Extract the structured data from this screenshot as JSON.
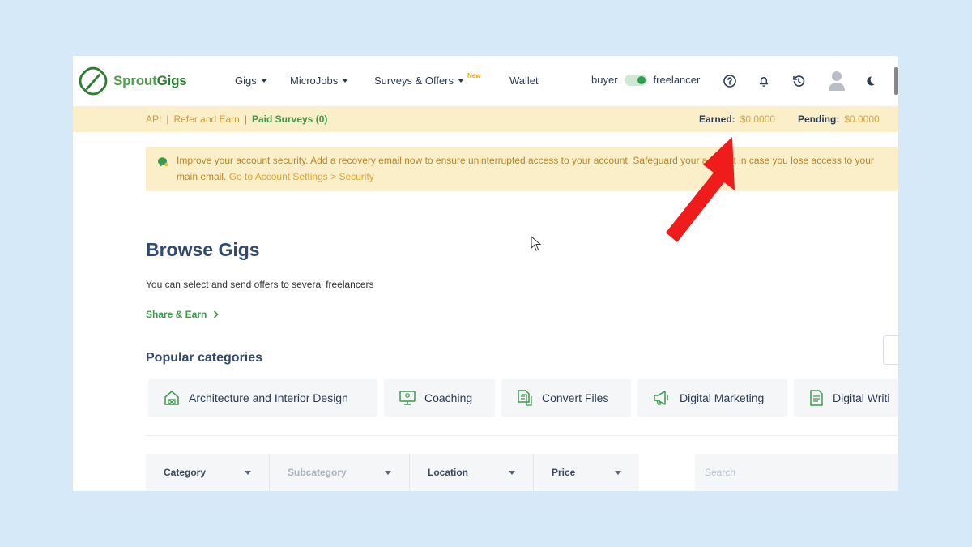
{
  "brand": {
    "name_light": "Sprout",
    "name_bold": "Gigs"
  },
  "nav": {
    "items": [
      {
        "label": "Gigs",
        "has_caret": true
      },
      {
        "label": "MicroJobs",
        "has_caret": true
      },
      {
        "label": "Surveys & Offers",
        "has_caret": true,
        "badge": "New"
      },
      {
        "label": "Wallet",
        "has_caret": false
      }
    ],
    "mode": {
      "left": "buyer",
      "right": "freelancer",
      "active": "freelancer"
    },
    "icons": [
      "help-icon",
      "bell-icon",
      "history-icon",
      "avatar",
      "dark-mode-icon"
    ]
  },
  "subbar": {
    "links": [
      "API",
      "Refer and Earn",
      "Paid Surveys (0)"
    ],
    "earned_label": "Earned:",
    "earned_value": "$0.0000",
    "pending_label": "Pending:",
    "pending_value": "$0.0000"
  },
  "alert": {
    "text": "Improve your account security. Add a recovery email now to ensure uninterrupted access to your account. Safeguard your account in case you lose access to your main email.",
    "link": "Go to Account Settings > Security"
  },
  "main": {
    "title": "Browse Gigs",
    "subtitle": "You can select and send offers to several freelancers",
    "share": "Share & Earn",
    "popular_heading": "Popular categories",
    "categories": [
      {
        "label": "Architecture and Interior Design",
        "icon": "building-icon"
      },
      {
        "label": "Coaching",
        "icon": "monitor-icon"
      },
      {
        "label": "Convert Files",
        "icon": "files-icon"
      },
      {
        "label": "Digital Marketing",
        "icon": "megaphone-icon"
      },
      {
        "label": "Digital Writi",
        "icon": "document-icon"
      }
    ]
  },
  "filters": {
    "category": "Category",
    "subcategory": "Subcategory",
    "location": "Location",
    "price": "Price",
    "search_placeholder": "Search"
  },
  "colors": {
    "brand_green": "#3c9a4a",
    "banner_bg": "#fbefc9",
    "heading": "#2f4a6e",
    "arrow_red": "#f01c1c"
  }
}
